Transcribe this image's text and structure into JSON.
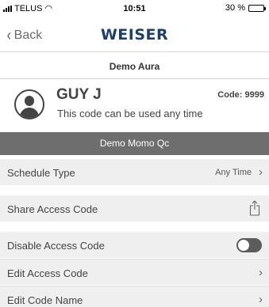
{
  "status_bar": {
    "carrier": "TELUS",
    "time": "10:51",
    "battery_text": "30 %",
    "battery_level": 0.3
  },
  "nav": {
    "back_label": "Back",
    "logo_text": "WEISER"
  },
  "lock_name": "Demo Aura",
  "user": {
    "name": "GUY J",
    "description": "This code can be used any time",
    "code": "Code: 9999"
  },
  "section_title": "Demo Momo Qc",
  "rows": {
    "schedule_type": {
      "label": "Schedule Type",
      "value": "Any Time"
    },
    "share_access_code": {
      "label": "Share Access Code"
    },
    "disable_access_code": {
      "label": "Disable Access Code",
      "enabled": false
    },
    "edit_access_code": {
      "label": "Edit Access Code"
    },
    "edit_code_name": {
      "label": "Edit Code Name"
    }
  },
  "icons": {
    "signal": "signal-bars-icon",
    "wifi": "wifi-icon",
    "battery": "battery-icon",
    "back": "chevron-left-icon",
    "avatar": "user-avatar-icon",
    "share": "share-icon",
    "chevron": "chevron-right-icon"
  },
  "colors": {
    "brand": "#1e3f66",
    "section_header_bg": "#6e6e6e",
    "row_bg": "#efefef",
    "toggle_off": "#5c5c5c"
  }
}
